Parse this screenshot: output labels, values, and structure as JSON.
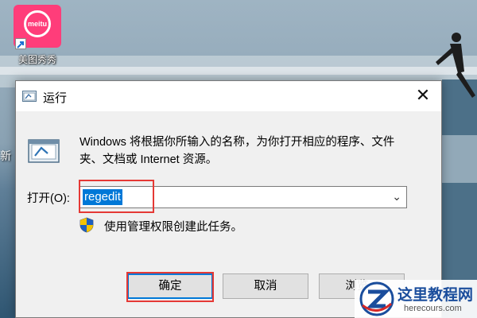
{
  "desktop": {
    "icon_label": "美图秀秀",
    "icon_badge": "meitu",
    "partial_label": "新"
  },
  "dialog": {
    "title": "运行",
    "close_glyph": "✕",
    "description": "Windows 将根据你所输入的名称，为你打开相应的程序、文件夹、文档或 Internet 资源。",
    "open_label": "打开(O):",
    "open_value": "regedit",
    "dropdown_glyph": "⌄",
    "admin_note": "使用管理权限创建此任务。",
    "buttons": {
      "ok": "确定",
      "cancel": "取消",
      "browse": "浏览..."
    }
  },
  "watermark": {
    "title": "这里教程网",
    "url": "herecours.com"
  },
  "colors": {
    "highlight_annotation": "#e53935",
    "selection": "#0078d7",
    "meitu_brand": "#ff3d7a"
  }
}
